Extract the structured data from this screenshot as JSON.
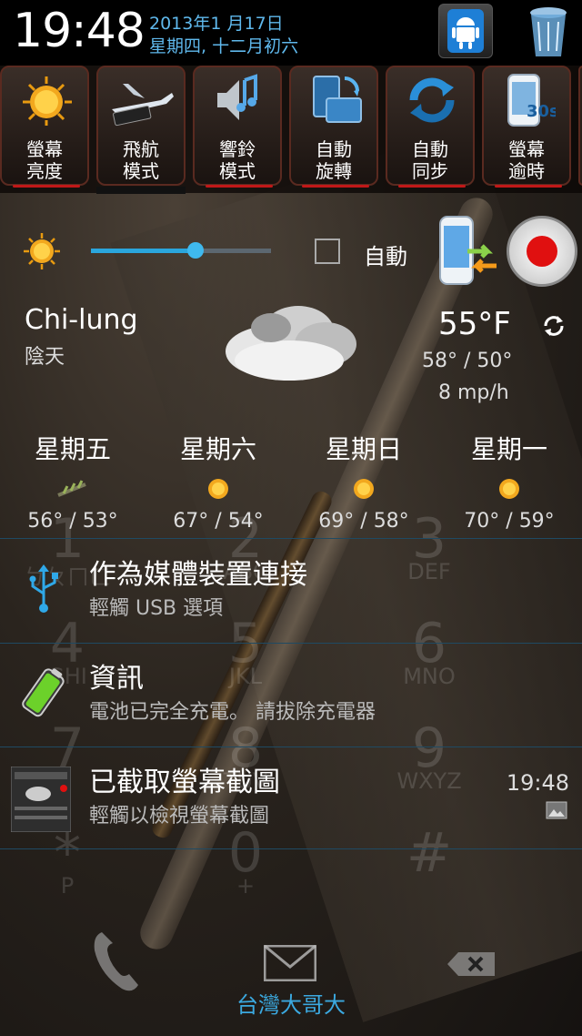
{
  "status": {
    "time": "19:48",
    "date_line1": "2013年1 月17日",
    "date_line2": "星期四, 十二月初六"
  },
  "toggles": [
    {
      "label1": "螢幕",
      "label2": "亮度",
      "icon": "sun-icon"
    },
    {
      "label1": "飛航",
      "label2": "模式",
      "icon": "airplane-icon"
    },
    {
      "label1": "響鈴",
      "label2": "模式",
      "icon": "speaker-icon"
    },
    {
      "label1": "自動",
      "label2": "旋轉",
      "icon": "rotate-icon"
    },
    {
      "label1": "自動",
      "label2": "同步",
      "icon": "sync-icon"
    },
    {
      "label1": "螢幕",
      "label2": "逾時",
      "icon": "phone-timeout-icon",
      "badge": "30s"
    }
  ],
  "brightness": {
    "auto_label": "自動",
    "level": 0.58
  },
  "weather": {
    "city": "Chi-lung",
    "condition": "陰天",
    "temp": "55°F",
    "hilo": "58° / 50°",
    "wind": "8 mp/h"
  },
  "forecast": [
    {
      "day": "星期五",
      "temps": "56° / 53°",
      "icon": "windy-icon"
    },
    {
      "day": "星期六",
      "temps": "67° / 54°",
      "icon": "sun-icon"
    },
    {
      "day": "星期日",
      "temps": "69° / 58°",
      "icon": "sun-icon"
    },
    {
      "day": "星期一",
      "temps": "70° / 59°",
      "icon": "sun-icon"
    }
  ],
  "notifications": [
    {
      "title": "作為媒體裝置連接",
      "sub": "輕觸 USB 選項",
      "icon": "usb-icon"
    },
    {
      "title": "資訊",
      "sub": "電池已完全充電。 請拔除充電器",
      "icon": "battery-icon"
    },
    {
      "title": "已截取螢幕截圖",
      "sub": "輕觸以檢視螢幕截圖",
      "time": "19:48",
      "icon": "screenshot-icon"
    }
  ],
  "dialpad": [
    {
      "n": "1",
      "l": "ㄅㄆㄇㄈ"
    },
    {
      "n": "2",
      "l": "ABC"
    },
    {
      "n": "3",
      "l": "DEF"
    },
    {
      "n": "4",
      "l": "GHI"
    },
    {
      "n": "5",
      "l": "JKL"
    },
    {
      "n": "6",
      "l": "MNO"
    },
    {
      "n": "7",
      "l": ""
    },
    {
      "n": "8",
      "l": "TUV"
    },
    {
      "n": "9",
      "l": "WXYZ"
    },
    {
      "n": "*",
      "l": "P"
    },
    {
      "n": "0",
      "l": "+"
    },
    {
      "n": "#",
      "l": ""
    }
  ],
  "carrier": "台灣大哥大"
}
